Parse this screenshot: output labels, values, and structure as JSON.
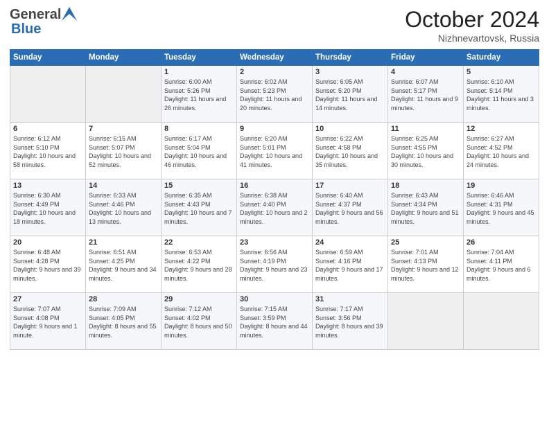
{
  "header": {
    "logo_general": "General",
    "logo_blue": "Blue",
    "title": "October 2024",
    "location": "Nizhnevartovsk, Russia"
  },
  "days_of_week": [
    "Sunday",
    "Monday",
    "Tuesday",
    "Wednesday",
    "Thursday",
    "Friday",
    "Saturday"
  ],
  "weeks": [
    [
      {
        "day": "",
        "info": ""
      },
      {
        "day": "",
        "info": ""
      },
      {
        "day": "1",
        "sunrise": "6:00 AM",
        "sunset": "5:26 PM",
        "daylight": "11 hours and 26 minutes."
      },
      {
        "day": "2",
        "sunrise": "6:02 AM",
        "sunset": "5:23 PM",
        "daylight": "11 hours and 20 minutes."
      },
      {
        "day": "3",
        "sunrise": "6:05 AM",
        "sunset": "5:20 PM",
        "daylight": "11 hours and 14 minutes."
      },
      {
        "day": "4",
        "sunrise": "6:07 AM",
        "sunset": "5:17 PM",
        "daylight": "11 hours and 9 minutes."
      },
      {
        "day": "5",
        "sunrise": "6:10 AM",
        "sunset": "5:14 PM",
        "daylight": "11 hours and 3 minutes."
      }
    ],
    [
      {
        "day": "6",
        "sunrise": "6:12 AM",
        "sunset": "5:10 PM",
        "daylight": "10 hours and 58 minutes."
      },
      {
        "day": "7",
        "sunrise": "6:15 AM",
        "sunset": "5:07 PM",
        "daylight": "10 hours and 52 minutes."
      },
      {
        "day": "8",
        "sunrise": "6:17 AM",
        "sunset": "5:04 PM",
        "daylight": "10 hours and 46 minutes."
      },
      {
        "day": "9",
        "sunrise": "6:20 AM",
        "sunset": "5:01 PM",
        "daylight": "10 hours and 41 minutes."
      },
      {
        "day": "10",
        "sunrise": "6:22 AM",
        "sunset": "4:58 PM",
        "daylight": "10 hours and 35 minutes."
      },
      {
        "day": "11",
        "sunrise": "6:25 AM",
        "sunset": "4:55 PM",
        "daylight": "10 hours and 30 minutes."
      },
      {
        "day": "12",
        "sunrise": "6:27 AM",
        "sunset": "4:52 PM",
        "daylight": "10 hours and 24 minutes."
      }
    ],
    [
      {
        "day": "13",
        "sunrise": "6:30 AM",
        "sunset": "4:49 PM",
        "daylight": "10 hours and 18 minutes."
      },
      {
        "day": "14",
        "sunrise": "6:33 AM",
        "sunset": "4:46 PM",
        "daylight": "10 hours and 13 minutes."
      },
      {
        "day": "15",
        "sunrise": "6:35 AM",
        "sunset": "4:43 PM",
        "daylight": "10 hours and 7 minutes."
      },
      {
        "day": "16",
        "sunrise": "6:38 AM",
        "sunset": "4:40 PM",
        "daylight": "10 hours and 2 minutes."
      },
      {
        "day": "17",
        "sunrise": "6:40 AM",
        "sunset": "4:37 PM",
        "daylight": "9 hours and 56 minutes."
      },
      {
        "day": "18",
        "sunrise": "6:43 AM",
        "sunset": "4:34 PM",
        "daylight": "9 hours and 51 minutes."
      },
      {
        "day": "19",
        "sunrise": "6:46 AM",
        "sunset": "4:31 PM",
        "daylight": "9 hours and 45 minutes."
      }
    ],
    [
      {
        "day": "20",
        "sunrise": "6:48 AM",
        "sunset": "4:28 PM",
        "daylight": "9 hours and 39 minutes."
      },
      {
        "day": "21",
        "sunrise": "6:51 AM",
        "sunset": "4:25 PM",
        "daylight": "9 hours and 34 minutes."
      },
      {
        "day": "22",
        "sunrise": "6:53 AM",
        "sunset": "4:22 PM",
        "daylight": "9 hours and 28 minutes."
      },
      {
        "day": "23",
        "sunrise": "6:56 AM",
        "sunset": "4:19 PM",
        "daylight": "9 hours and 23 minutes."
      },
      {
        "day": "24",
        "sunrise": "6:59 AM",
        "sunset": "4:16 PM",
        "daylight": "9 hours and 17 minutes."
      },
      {
        "day": "25",
        "sunrise": "7:01 AM",
        "sunset": "4:13 PM",
        "daylight": "9 hours and 12 minutes."
      },
      {
        "day": "26",
        "sunrise": "7:04 AM",
        "sunset": "4:11 PM",
        "daylight": "9 hours and 6 minutes."
      }
    ],
    [
      {
        "day": "27",
        "sunrise": "7:07 AM",
        "sunset": "4:08 PM",
        "daylight": "9 hours and 1 minute."
      },
      {
        "day": "28",
        "sunrise": "7:09 AM",
        "sunset": "4:05 PM",
        "daylight": "8 hours and 55 minutes."
      },
      {
        "day": "29",
        "sunrise": "7:12 AM",
        "sunset": "4:02 PM",
        "daylight": "8 hours and 50 minutes."
      },
      {
        "day": "30",
        "sunrise": "7:15 AM",
        "sunset": "3:59 PM",
        "daylight": "8 hours and 44 minutes."
      },
      {
        "day": "31",
        "sunrise": "7:17 AM",
        "sunset": "3:56 PM",
        "daylight": "8 hours and 39 minutes."
      },
      {
        "day": "",
        "info": ""
      },
      {
        "day": "",
        "info": ""
      }
    ]
  ],
  "labels": {
    "sunrise_label": "Sunrise:",
    "sunset_label": "Sunset:",
    "daylight_label": "Daylight:"
  }
}
